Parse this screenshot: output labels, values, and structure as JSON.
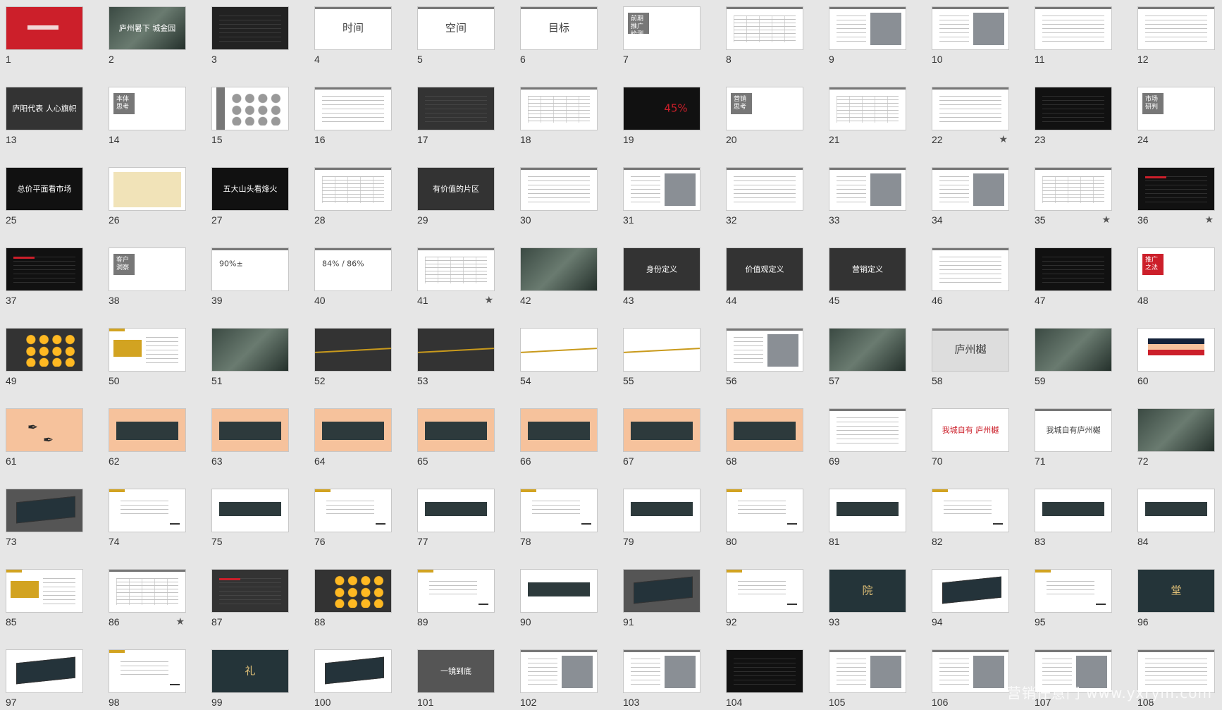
{
  "watermark": "营销任意门 www.yxrym.com",
  "colors": {
    "background": "#e6e6e6",
    "dark": "#333333",
    "black": "#111111",
    "red": "#cc1f2a",
    "gold": "#d2a321",
    "peach": "#f6c29c",
    "teal": "#243439",
    "white": "#ffffff"
  },
  "slides": [
    {
      "n": "1",
      "bg": "#cc1f2a",
      "text": "",
      "style": "red-title"
    },
    {
      "n": "2",
      "bg": "#3b4a43",
      "text": "庐州暑下 城金园",
      "style": "photo"
    },
    {
      "n": "3",
      "bg": "#222222",
      "text": "",
      "style": "dark-lines"
    },
    {
      "n": "4",
      "bg": "#ffffff",
      "text": "时间",
      "style": "big-dark"
    },
    {
      "n": "5",
      "bg": "#ffffff",
      "text": "空间",
      "style": "big-dark"
    },
    {
      "n": "6",
      "bg": "#ffffff",
      "text": "目标",
      "style": "big-dark"
    },
    {
      "n": "7",
      "bg": "#ffffff",
      "text": "前期推广检测",
      "style": "tag"
    },
    {
      "n": "8",
      "bg": "#ffffff",
      "text": "",
      "style": "table"
    },
    {
      "n": "9",
      "bg": "#ffffff",
      "text": "",
      "style": "collage"
    },
    {
      "n": "10",
      "bg": "#ffffff",
      "text": "",
      "style": "collage"
    },
    {
      "n": "11",
      "bg": "#ffffff",
      "text": "",
      "style": "lines"
    },
    {
      "n": "12",
      "bg": "#ffffff",
      "text": "",
      "style": "lines"
    },
    {
      "n": "13",
      "bg": "#333333",
      "text": "庐阳代表 人心旗帜",
      "style": "dark-white"
    },
    {
      "n": "14",
      "bg": "#ffffff",
      "text": "本体思考",
      "style": "tag"
    },
    {
      "n": "15",
      "bg": "#ffffff",
      "text": "",
      "style": "circles"
    },
    {
      "n": "16",
      "bg": "#ffffff",
      "text": "",
      "style": "lines"
    },
    {
      "n": "17",
      "bg": "#333333",
      "text": "",
      "style": "dark-lines"
    },
    {
      "n": "18",
      "bg": "#ffffff",
      "text": "",
      "style": "table"
    },
    {
      "n": "19",
      "bg": "#111111",
      "text": "45%",
      "style": "percent"
    },
    {
      "n": "20",
      "bg": "#ffffff",
      "text": "营销思考",
      "style": "tag"
    },
    {
      "n": "21",
      "bg": "#ffffff",
      "text": "",
      "style": "table"
    },
    {
      "n": "22",
      "bg": "#ffffff",
      "text": "",
      "style": "lines",
      "star": "★"
    },
    {
      "n": "23",
      "bg": "#111111",
      "text": "",
      "style": "dark-lines"
    },
    {
      "n": "24",
      "bg": "#ffffff",
      "text": "市场研判",
      "style": "tag"
    },
    {
      "n": "25",
      "bg": "#111111",
      "text": "总价平面看市场",
      "style": "dark-white"
    },
    {
      "n": "26",
      "bg": "#ffffff",
      "text": "",
      "style": "map"
    },
    {
      "n": "27",
      "bg": "#111111",
      "text": "五大山头看烽火",
      "style": "dark-white"
    },
    {
      "n": "28",
      "bg": "#ffffff",
      "text": "",
      "style": "table"
    },
    {
      "n": "29",
      "bg": "#333333",
      "text": "有价值的片区",
      "style": "dark-white"
    },
    {
      "n": "30",
      "bg": "#ffffff",
      "text": "",
      "style": "lines"
    },
    {
      "n": "31",
      "bg": "#ffffff",
      "text": "",
      "style": "collage"
    },
    {
      "n": "32",
      "bg": "#ffffff",
      "text": "",
      "style": "lines"
    },
    {
      "n": "33",
      "bg": "#ffffff",
      "text": "",
      "style": "collage"
    },
    {
      "n": "34",
      "bg": "#ffffff",
      "text": "",
      "style": "collage"
    },
    {
      "n": "35",
      "bg": "#ffffff",
      "text": "",
      "style": "table",
      "star": "★"
    },
    {
      "n": "36",
      "bg": "#111111",
      "text": "",
      "style": "dark-red",
      "star": "★"
    },
    {
      "n": "37",
      "bg": "#111111",
      "text": "",
      "style": "dark-red"
    },
    {
      "n": "38",
      "bg": "#ffffff",
      "text": "客户洞察",
      "style": "tag"
    },
    {
      "n": "39",
      "bg": "#ffffff",
      "text": "90%±",
      "style": "chart"
    },
    {
      "n": "40",
      "bg": "#ffffff",
      "text": "84% / 86%",
      "style": "chart"
    },
    {
      "n": "41",
      "bg": "#ffffff",
      "text": "",
      "style": "table",
      "star": "★"
    },
    {
      "n": "42",
      "bg": "#333333",
      "text": "",
      "style": "photo"
    },
    {
      "n": "43",
      "bg": "#333333",
      "text": "身份定义",
      "style": "dark-white"
    },
    {
      "n": "44",
      "bg": "#333333",
      "text": "价值观定义",
      "style": "dark-white"
    },
    {
      "n": "45",
      "bg": "#333333",
      "text": "营销定义",
      "style": "dark-white"
    },
    {
      "n": "46",
      "bg": "#ffffff",
      "text": "",
      "style": "lines"
    },
    {
      "n": "47",
      "bg": "#111111",
      "text": "",
      "style": "dark-lines"
    },
    {
      "n": "48",
      "bg": "#ffffff",
      "text": "推广之法",
      "style": "red-tag"
    },
    {
      "n": "49",
      "bg": "#333333",
      "text": "",
      "style": "gold-circles"
    },
    {
      "n": "50",
      "bg": "#ffffff",
      "text": "",
      "style": "gold-box"
    },
    {
      "n": "51",
      "bg": "#3a2e24",
      "text": "",
      "style": "photo"
    },
    {
      "n": "52",
      "bg": "#333333",
      "text": "",
      "style": "gold-wave"
    },
    {
      "n": "53",
      "bg": "#333333",
      "text": "",
      "style": "gold-wave"
    },
    {
      "n": "54",
      "bg": "#ffffff",
      "text": "",
      "style": "gold-wave"
    },
    {
      "n": "55",
      "bg": "#ffffff",
      "text": "",
      "style": "gold-wave"
    },
    {
      "n": "56",
      "bg": "#ffffff",
      "text": "",
      "style": "collage"
    },
    {
      "n": "57",
      "bg": "#555555",
      "text": "",
      "style": "photo"
    },
    {
      "n": "58",
      "bg": "#dddddd",
      "text": "庐州樾",
      "style": "big-dark"
    },
    {
      "n": "59",
      "bg": "#243439",
      "text": "",
      "style": "photo"
    },
    {
      "n": "60",
      "bg": "#ffffff",
      "text": "",
      "style": "flag"
    },
    {
      "n": "61",
      "bg": "#f6c29c",
      "text": "",
      "style": "birds"
    },
    {
      "n": "62",
      "bg": "#f6c29c",
      "text": "",
      "style": "panel"
    },
    {
      "n": "63",
      "bg": "#f6c29c",
      "text": "",
      "style": "panel"
    },
    {
      "n": "64",
      "bg": "#f6c29c",
      "text": "",
      "style": "panel"
    },
    {
      "n": "65",
      "bg": "#f6c29c",
      "text": "",
      "style": "panel"
    },
    {
      "n": "66",
      "bg": "#f6c29c",
      "text": "",
      "style": "panel"
    },
    {
      "n": "67",
      "bg": "#f6c29c",
      "text": "",
      "style": "panel"
    },
    {
      "n": "68",
      "bg": "#f6c29c",
      "text": "",
      "style": "panel"
    },
    {
      "n": "69",
      "bg": "#ffffff",
      "text": "",
      "style": "lines"
    },
    {
      "n": "70",
      "bg": "#ffffff",
      "text": "我城自有 庐州樾",
      "style": "red-text"
    },
    {
      "n": "71",
      "bg": "#ffffff",
      "text": "我城自有庐州樾",
      "style": "dark-text"
    },
    {
      "n": "72",
      "bg": "#243439",
      "text": "",
      "style": "photo"
    },
    {
      "n": "73",
      "bg": "#555555",
      "text": "",
      "style": "billboard"
    },
    {
      "n": "74",
      "bg": "#ffffff",
      "text": "",
      "style": "slogan"
    },
    {
      "n": "75",
      "bg": "#ffffff",
      "text": "",
      "style": "banner"
    },
    {
      "n": "76",
      "bg": "#ffffff",
      "text": "",
      "style": "slogan"
    },
    {
      "n": "77",
      "bg": "#ffffff",
      "text": "",
      "style": "banner"
    },
    {
      "n": "78",
      "bg": "#ffffff",
      "text": "",
      "style": "slogan"
    },
    {
      "n": "79",
      "bg": "#ffffff",
      "text": "",
      "style": "banner"
    },
    {
      "n": "80",
      "bg": "#ffffff",
      "text": "",
      "style": "slogan"
    },
    {
      "n": "81",
      "bg": "#ffffff",
      "text": "",
      "style": "banner"
    },
    {
      "n": "82",
      "bg": "#ffffff",
      "text": "",
      "style": "slogan"
    },
    {
      "n": "83",
      "bg": "#ffffff",
      "text": "",
      "style": "banner"
    },
    {
      "n": "84",
      "bg": "#ffffff",
      "text": "",
      "style": "banner"
    },
    {
      "n": "85",
      "bg": "#ffffff",
      "text": "",
      "style": "gold-box"
    },
    {
      "n": "86",
      "bg": "#ffffff",
      "text": "",
      "style": "table",
      "star": "★"
    },
    {
      "n": "87",
      "bg": "#333333",
      "text": "",
      "style": "dark-red"
    },
    {
      "n": "88",
      "bg": "#333333",
      "text": "",
      "style": "gold-circles"
    },
    {
      "n": "89",
      "bg": "#ffffff",
      "text": "",
      "style": "slogan"
    },
    {
      "n": "90",
      "bg": "#ffffff",
      "text": "",
      "style": "banner"
    },
    {
      "n": "91",
      "bg": "#555555",
      "text": "",
      "style": "billboard"
    },
    {
      "n": "92",
      "bg": "#ffffff",
      "text": "",
      "style": "slogan"
    },
    {
      "n": "93",
      "bg": "#243439",
      "text": "院",
      "style": "calligraphy"
    },
    {
      "n": "94",
      "bg": "#ffffff",
      "text": "",
      "style": "billboard"
    },
    {
      "n": "95",
      "bg": "#ffffff",
      "text": "",
      "style": "slogan"
    },
    {
      "n": "96",
      "bg": "#243439",
      "text": "堂",
      "style": "calligraphy"
    },
    {
      "n": "97",
      "bg": "#ffffff",
      "text": "",
      "style": "billboard"
    },
    {
      "n": "98",
      "bg": "#ffffff",
      "text": "",
      "style": "slogan"
    },
    {
      "n": "99",
      "bg": "#243439",
      "text": "礼",
      "style": "calligraphy"
    },
    {
      "n": "100",
      "bg": "#ffffff",
      "text": "",
      "style": "billboard"
    },
    {
      "n": "101",
      "bg": "#555555",
      "text": "一镜到底",
      "style": "dark-white"
    },
    {
      "n": "102",
      "bg": "#ffffff",
      "text": "",
      "style": "collage"
    },
    {
      "n": "103",
      "bg": "#ffffff",
      "text": "",
      "style": "collage"
    },
    {
      "n": "104",
      "bg": "#111111",
      "text": "",
      "style": "dark-lines"
    },
    {
      "n": "105",
      "bg": "#ffffff",
      "text": "",
      "style": "collage"
    },
    {
      "n": "106",
      "bg": "#ffffff",
      "text": "",
      "style": "collage"
    },
    {
      "n": "107",
      "bg": "#ffffff",
      "text": "",
      "style": "collage"
    },
    {
      "n": "108",
      "bg": "#ffffff",
      "text": "",
      "style": "lines"
    }
  ]
}
